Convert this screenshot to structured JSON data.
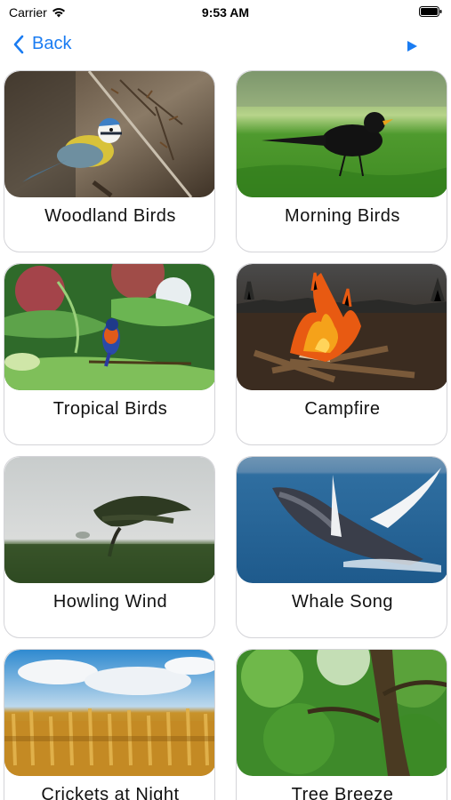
{
  "status_bar": {
    "carrier": "Carrier",
    "time": "9:53 AM"
  },
  "nav": {
    "back_label": "Back"
  },
  "colors": {
    "accent": "#1a7cf2"
  },
  "cards": [
    {
      "title": "Woodland Birds"
    },
    {
      "title": "Morning Birds"
    },
    {
      "title": "Tropical Birds"
    },
    {
      "title": "Campfire"
    },
    {
      "title": "Howling Wind"
    },
    {
      "title": "Whale Song"
    },
    {
      "title": "Crickets at Night"
    },
    {
      "title": "Tree Breeze"
    }
  ]
}
